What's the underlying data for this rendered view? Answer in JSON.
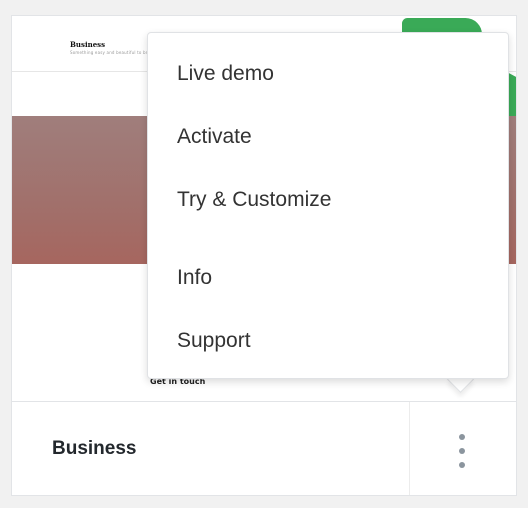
{
  "preview": {
    "logo_text": "Business",
    "tagline": "Something easy and beautiful to browse",
    "cta_text": "Get in touch"
  },
  "card": {
    "theme_name": "Business"
  },
  "menu": {
    "items": [
      {
        "label": "Live demo"
      },
      {
        "label": "Activate"
      },
      {
        "label": "Try & Customize"
      },
      {
        "label": "Info"
      },
      {
        "label": "Support"
      }
    ]
  },
  "colors": {
    "accent_green": "#3aaa57",
    "hero_color": "#a1706b",
    "kebab_color": "#8b959e",
    "text_dark": "#23282d"
  },
  "icons": {
    "more": "kebab-vertical-icon"
  }
}
